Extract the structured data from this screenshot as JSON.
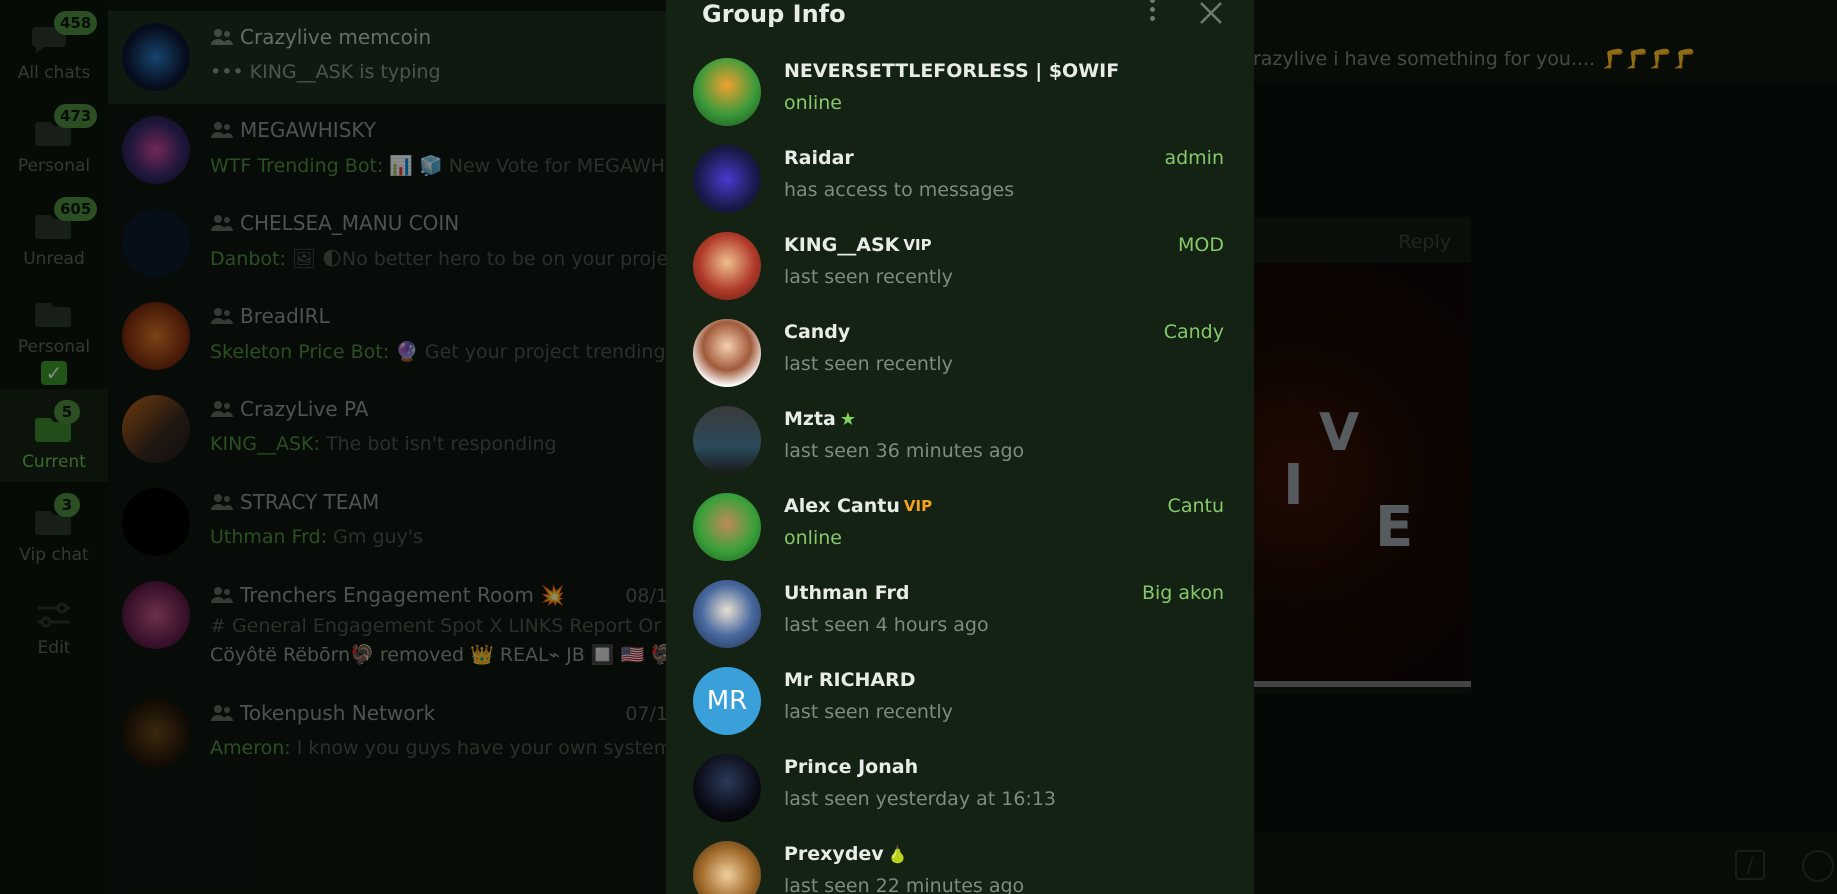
{
  "folders": [
    {
      "label": "All chats",
      "badge": "458"
    },
    {
      "label": "Personal",
      "badge": "473"
    },
    {
      "label": "Unread",
      "badge": "605"
    },
    {
      "label": "Personal",
      "badge": "",
      "extra": "✓"
    },
    {
      "label": "Current",
      "badge": "5"
    },
    {
      "label": "Vip chat",
      "badge": "3"
    },
    {
      "label": "Edit",
      "badge": ""
    }
  ],
  "chats": [
    {
      "title": "Crazylive memcoin",
      "sender": "",
      "preview": "••• KING__ASK is typing",
      "date": ""
    },
    {
      "title": "MEGAWHISKY",
      "sender": "WTF Trending Bot:",
      "preview": "📊 🧊 New Vote for MEGAWHIS",
      "date": ""
    },
    {
      "title": "CHELSEA_MANU COIN",
      "sender": "Danbot:",
      "preview": "🖼 🌓No better hero to be on your projec",
      "date": ""
    },
    {
      "title": "BreadIRL",
      "sender": "Skeleton Price Bot:",
      "preview": "🔮 Get your project trending o...",
      "date": ""
    },
    {
      "title": "CrazyLive PA",
      "sender": "KING__ASK:",
      "preview": "The bot isn't responding",
      "date": ""
    },
    {
      "title": "STRACY TEAM",
      "sender": "Uthman Frd:",
      "preview": "Gm guy's",
      "date": ""
    },
    {
      "title": "Trenchers Engagement Room 💥",
      "sender": "",
      "preview": "# General  Engagement Spot  X LINKS  Report Or C",
      "preview2": "Cöyôtë Rëbōrn🦃 removed 👑 REAL⌁ JB 🔲 🇺🇸 🦃",
      "date": "08/1"
    },
    {
      "title": "Tokenpush Network",
      "sender": "Ameron:",
      "preview": "I know you guys have your own system al",
      "date": "07/1"
    }
  ],
  "chat_area": {
    "pinned_text": "razylive i have something for you.... 🦵🦵🦵🦵",
    "reply_label": "Reply",
    "media_letters": [
      "V",
      "I",
      "E"
    ]
  },
  "group_info": {
    "title": "Group Info",
    "members": [
      {
        "name": "NEVERSETTLEFORLESS | $OWIF",
        "status": "online",
        "role": "",
        "online": true
      },
      {
        "name": "Raidar",
        "status": "has access to messages",
        "role": "admin",
        "online": false
      },
      {
        "name": "KING__ASK",
        "badge": "VIP",
        "status": "last seen recently",
        "role": "MOD",
        "online": false
      },
      {
        "name": "Candy",
        "status": "last seen recently",
        "role": "Candy",
        "online": false
      },
      {
        "name": "Mzta",
        "badge": "★",
        "status": "last seen 36 minutes ago",
        "role": "",
        "online": false
      },
      {
        "name": "Alex Cantu",
        "badge": "VIP",
        "status": "online",
        "role": "Cantu",
        "online": true
      },
      {
        "name": "Uthman Frd",
        "status": "last seen 4 hours ago",
        "role": "Big akon",
        "online": false
      },
      {
        "name": "Mr RICHARD",
        "initials": "MR",
        "status": "last seen recently",
        "role": "",
        "online": false
      },
      {
        "name": "Prince Jonah",
        "status": "last seen yesterday at 16:13",
        "role": "",
        "online": false
      },
      {
        "name": "Prexydev",
        "badge": "🍐",
        "status": "last seen 22 minutes ago",
        "role": "",
        "online": false
      }
    ]
  },
  "colors": {
    "accent": "#6fbf58",
    "online": "#86c86a",
    "modal_bg": "#142214"
  }
}
